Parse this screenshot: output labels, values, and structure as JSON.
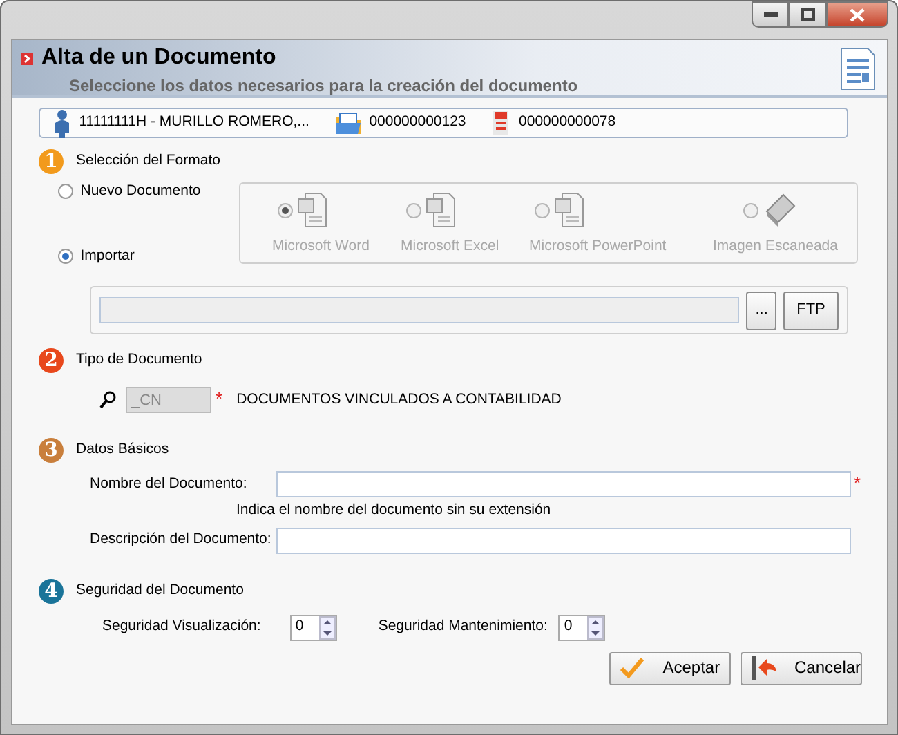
{
  "header": {
    "title": "Alta de un Documento",
    "subtitle": "Seleccione los datos necesarios para la creación del documento"
  },
  "info_bar": [
    {
      "kind": "person",
      "text": "11111111H - MURILLO ROMERO,..."
    },
    {
      "kind": "folder",
      "text": "000000000123"
    },
    {
      "kind": "document",
      "text": "000000000078"
    }
  ],
  "format_section": {
    "number": "1",
    "color": "#f29a1c",
    "title": "Selección del Formato",
    "sources": [
      {
        "label": "Nuevo Documento",
        "selected": false
      },
      {
        "label": "Importar",
        "selected": true
      }
    ],
    "formats": [
      {
        "kind": "word",
        "label": "Microsoft Word",
        "selected": true,
        "disabled": true
      },
      {
        "kind": "excel",
        "label": "Microsoft Excel",
        "selected": false,
        "disabled": true
      },
      {
        "kind": "powerpoint",
        "label": "Microsoft PowerPoint",
        "selected": false,
        "disabled": true
      },
      {
        "kind": "scanner",
        "label": "Imagen Escaneada",
        "selected": false,
        "disabled": true
      }
    ],
    "file_buttons": [
      "...",
      "FTP"
    ]
  },
  "type_section": {
    "number": "2",
    "color": "#e8481c",
    "title": "Tipo de Documento",
    "code": "_CN",
    "required_mark": "*",
    "description": "DOCUMENTOS VINCULADOS A CONTABILIDAD"
  },
  "basic_section": {
    "number": "3",
    "color": "#c97f3c",
    "title": "Datos Básicos",
    "fields": [
      {
        "label": "Nombre del Documento:",
        "required_mark": "*",
        "hint": "Indica el nombre del documento sin su extensión"
      },
      {
        "label": "Descripción del Documento:"
      }
    ]
  },
  "security_section": {
    "number": "4",
    "color": "#1a7499",
    "title": "Seguridad del Documento",
    "spinners": [
      {
        "label": "Seguridad Visualización:",
        "value": "0"
      },
      {
        "label": "Seguridad Mantenimiento:",
        "value": "0"
      }
    ]
  },
  "buttons": [
    {
      "kind": "accept",
      "label": "Aceptar"
    },
    {
      "kind": "cancel",
      "label": "Cancelar"
    }
  ]
}
